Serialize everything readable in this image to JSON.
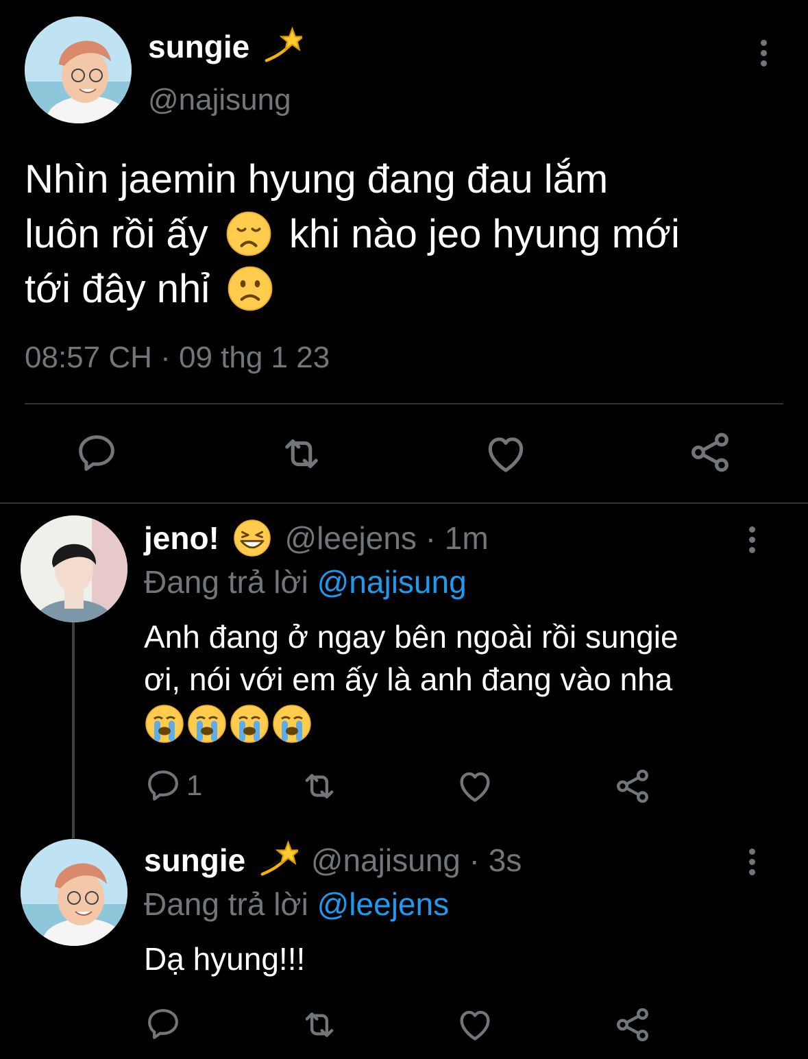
{
  "main_tweet": {
    "display_name": "sungie",
    "name_emoji": "dizzy-emoji",
    "handle": "@najisung",
    "text_line1": "Nhìn jaemin hyung đang đau lắm",
    "text_line2_a": "luôn rồi ấy",
    "text_line2_b": "khi nào jeo hyung mới",
    "text_line3": "tới đây nhỉ",
    "timestamp": "08:57 CH · 09 thg 1 23"
  },
  "reply1": {
    "display_name": "jeno!",
    "name_emoji": "grinning-emoji",
    "handle_time": "@leejens · 1m",
    "replying_prefix": "Đang trả lời",
    "replying_to": "@najisung",
    "text_line1": "Anh đang ở ngay bên ngoài rồi sungie",
    "text_line2": "ơi, nói với em ấy là anh đang vào nha",
    "reply_count": "1"
  },
  "reply2": {
    "display_name": "sungie",
    "name_emoji": "dizzy-emoji",
    "handle_time": "@najisung · 3s",
    "replying_prefix": "Đang trả lời",
    "replying_to": "@leejens",
    "text": "Dạ hyung!!!"
  },
  "colors": {
    "background": "#000000",
    "text": "#e7e9ea",
    "muted": "#71767b",
    "link": "#1d9bf0",
    "divider": "#2f3336"
  }
}
